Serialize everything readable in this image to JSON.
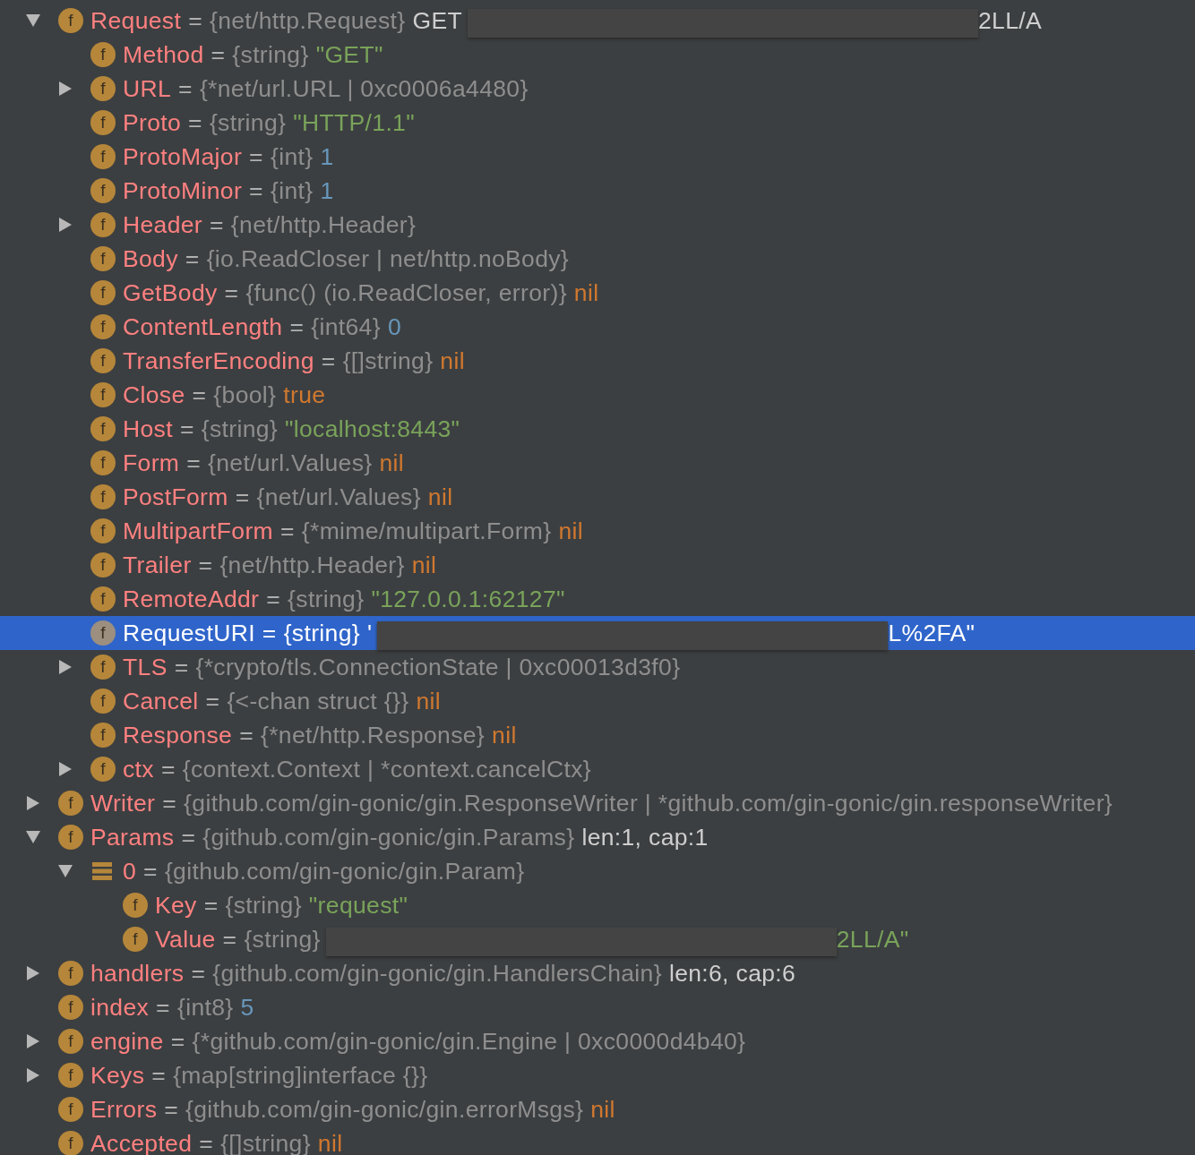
{
  "tree": [
    {
      "name": "Request",
      "kind": "field",
      "badge": "f",
      "equals": "=",
      "type": "{net/http.Request}",
      "value": {
        "kind": "plain",
        "text": "GET"
      },
      "redacted": true,
      "value_tail": {
        "kind": "plain",
        "text": "2LL/A"
      },
      "expanded": true,
      "selected": false,
      "children": [
        {
          "name": "Method",
          "kind": "field",
          "badge": "f",
          "equals": "=",
          "type": "{string}",
          "value": {
            "kind": "string",
            "text": "\"GET\""
          },
          "selected": false
        },
        {
          "name": "URL",
          "kind": "field",
          "badge": "f",
          "equals": "=",
          "type": "{*net/url.URL | 0xc0006a4480}",
          "expanded": false,
          "selected": false
        },
        {
          "name": "Proto",
          "kind": "field",
          "badge": "f",
          "equals": "=",
          "type": "{string}",
          "value": {
            "kind": "string",
            "text": "\"HTTP/1.1\""
          },
          "selected": false
        },
        {
          "name": "ProtoMajor",
          "kind": "field",
          "badge": "f",
          "equals": "=",
          "type": "{int}",
          "value": {
            "kind": "number",
            "text": "1"
          },
          "selected": false
        },
        {
          "name": "ProtoMinor",
          "kind": "field",
          "badge": "f",
          "equals": "=",
          "type": "{int}",
          "value": {
            "kind": "number",
            "text": "1"
          },
          "selected": false
        },
        {
          "name": "Header",
          "kind": "field",
          "badge": "f",
          "equals": "=",
          "type": "{net/http.Header}",
          "expanded": false,
          "selected": false
        },
        {
          "name": "Body",
          "kind": "field",
          "badge": "f",
          "equals": "=",
          "type": "{io.ReadCloser | net/http.noBody}",
          "selected": false
        },
        {
          "name": "GetBody",
          "kind": "field",
          "badge": "f",
          "equals": "=",
          "type": "{func() (io.ReadCloser, error)}",
          "value": {
            "kind": "keyword",
            "text": "nil"
          },
          "selected": false
        },
        {
          "name": "ContentLength",
          "kind": "field",
          "badge": "f",
          "equals": "=",
          "type": "{int64}",
          "value": {
            "kind": "number",
            "text": "0"
          },
          "selected": false
        },
        {
          "name": "TransferEncoding",
          "kind": "field",
          "badge": "f",
          "equals": "=",
          "type": "{[]string}",
          "value": {
            "kind": "keyword",
            "text": "nil"
          },
          "selected": false
        },
        {
          "name": "Close",
          "kind": "field",
          "badge": "f",
          "equals": "=",
          "type": "{bool}",
          "value": {
            "kind": "keyword",
            "text": "true"
          },
          "selected": false
        },
        {
          "name": "Host",
          "kind": "field",
          "badge": "f",
          "equals": "=",
          "type": "{string}",
          "value": {
            "kind": "string",
            "text": "\"localhost:8443\""
          },
          "selected": false
        },
        {
          "name": "Form",
          "kind": "field",
          "badge": "f",
          "equals": "=",
          "type": "{net/url.Values}",
          "value": {
            "kind": "keyword",
            "text": "nil"
          },
          "selected": false
        },
        {
          "name": "PostForm",
          "kind": "field",
          "badge": "f",
          "equals": "=",
          "type": "{net/url.Values}",
          "value": {
            "kind": "keyword",
            "text": "nil"
          },
          "selected": false
        },
        {
          "name": "MultipartForm",
          "kind": "field",
          "badge": "f",
          "equals": "=",
          "type": "{*mime/multipart.Form}",
          "value": {
            "kind": "keyword",
            "text": "nil"
          },
          "selected": false
        },
        {
          "name": "Trailer",
          "kind": "field",
          "badge": "f",
          "equals": "=",
          "type": "{net/http.Header}",
          "value": {
            "kind": "keyword",
            "text": "nil"
          },
          "selected": false
        },
        {
          "name": "RemoteAddr",
          "kind": "field",
          "badge": "f",
          "equals": "=",
          "type": "{string}",
          "value": {
            "kind": "string",
            "text": "\"127.0.0.1:62127\""
          },
          "selected": false
        },
        {
          "name": "RequestURI",
          "kind": "field",
          "badge": "f",
          "equals": "=",
          "type": "{string}",
          "value": {
            "text": "'"
          },
          "redacted": true,
          "value_tail": {
            "text": "L%2FA\""
          },
          "selected": true
        },
        {
          "name": "TLS",
          "kind": "field",
          "badge": "f",
          "equals": "=",
          "type": "{*crypto/tls.ConnectionState | 0xc00013d3f0}",
          "expanded": false,
          "selected": false
        },
        {
          "name": "Cancel",
          "kind": "field",
          "badge": "f",
          "equals": "=",
          "type": "{<-chan struct {}}",
          "value": {
            "kind": "keyword",
            "text": "nil"
          },
          "selected": false
        },
        {
          "name": "Response",
          "kind": "field",
          "badge": "f",
          "equals": "=",
          "type": "{*net/http.Response}",
          "value": {
            "kind": "keyword",
            "text": "nil"
          },
          "selected": false
        },
        {
          "name": "ctx",
          "kind": "field",
          "badge": "f",
          "equals": "=",
          "type": "{context.Context | *context.cancelCtx}",
          "expanded": false,
          "selected": false
        }
      ]
    },
    {
      "name": "Writer",
      "kind": "field",
      "badge": "f",
      "equals": "=",
      "type": "{github.com/gin-gonic/gin.ResponseWriter | *github.com/gin-gonic/gin.responseWriter}",
      "expanded": false,
      "selected": false
    },
    {
      "name": "Params",
      "kind": "field",
      "badge": "f",
      "equals": "=",
      "type": "{github.com/gin-gonic/gin.Params}",
      "value": {
        "kind": "plain",
        "text": "len:1, cap:1"
      },
      "expanded": true,
      "selected": false,
      "children": [
        {
          "name": "0",
          "kind": "element",
          "equals": "=",
          "type": "{github.com/gin-gonic/gin.Param}",
          "expanded": true,
          "selected": false,
          "children": [
            {
              "name": "Key",
              "kind": "field",
              "badge": "f",
              "equals": "=",
              "type": "{string}",
              "value": {
                "kind": "string",
                "text": "\"request\""
              },
              "selected": false
            },
            {
              "name": "Value",
              "kind": "field",
              "badge": "f",
              "equals": "=",
              "type": "{string}",
              "redacted": true,
              "value_tail": {
                "kind": "string",
                "text": "2LL/A\""
              },
              "selected": false
            }
          ]
        }
      ]
    },
    {
      "name": "handlers",
      "kind": "field",
      "badge": "f",
      "equals": "=",
      "type": "{github.com/gin-gonic/gin.HandlersChain}",
      "value": {
        "kind": "plain",
        "text": "len:6, cap:6"
      },
      "expanded": false,
      "selected": false
    },
    {
      "name": "index",
      "kind": "field",
      "badge": "f",
      "equals": "=",
      "type": "{int8}",
      "value": {
        "kind": "number",
        "text": "5"
      },
      "selected": false
    },
    {
      "name": "engine",
      "kind": "field",
      "badge": "f",
      "equals": "=",
      "type": "{*github.com/gin-gonic/gin.Engine | 0xc0000d4b40}",
      "expanded": false,
      "selected": false
    },
    {
      "name": "Keys",
      "kind": "field",
      "badge": "f",
      "equals": "=",
      "type": "{map[string]interface {}}",
      "expanded": false,
      "selected": false
    },
    {
      "name": "Errors",
      "kind": "field",
      "badge": "f",
      "equals": "=",
      "type": "{github.com/gin-gonic/gin.errorMsgs}",
      "value": {
        "kind": "keyword",
        "text": "nil"
      },
      "selected": false
    },
    {
      "name": "Accepted",
      "kind": "field",
      "badge": "f",
      "equals": "=",
      "type": "{[]string}",
      "value": {
        "kind": "keyword",
        "text": "nil"
      },
      "selected": false
    }
  ]
}
